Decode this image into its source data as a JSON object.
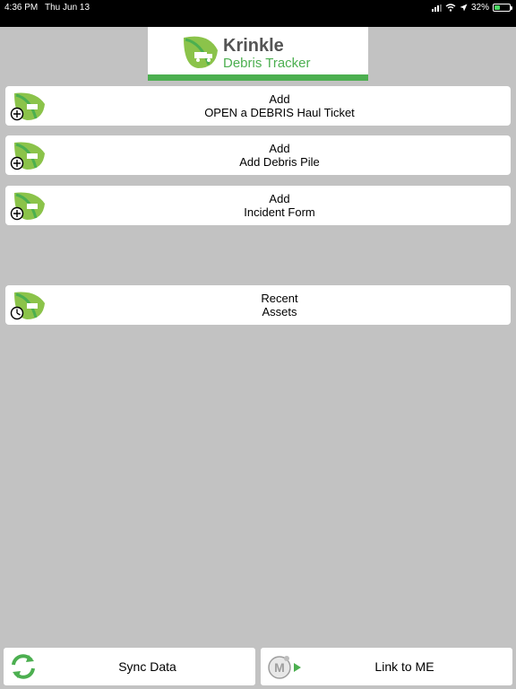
{
  "status_bar": {
    "time": "4:36 PM",
    "date": "Thu Jun 13",
    "battery": "32%"
  },
  "logo": {
    "title": "Krinkle",
    "subtitle": "Debris Tracker"
  },
  "menu": [
    {
      "line1": "Add",
      "line2": "OPEN a DEBRIS Haul Ticket",
      "icon": "add-icon"
    },
    {
      "line1": "Add",
      "line2": "Add Debris Pile",
      "icon": "add-icon"
    },
    {
      "line1": "Add",
      "line2": "Incident Form",
      "icon": "add-icon"
    },
    {
      "line1": "Recent",
      "line2": "Assets",
      "icon": "clock-icon"
    }
  ],
  "bottom": {
    "sync_label": "Sync Data",
    "link_label": "Link to ME"
  },
  "colors": {
    "brand_green": "#4caf50",
    "background": "#c2c2c2"
  }
}
